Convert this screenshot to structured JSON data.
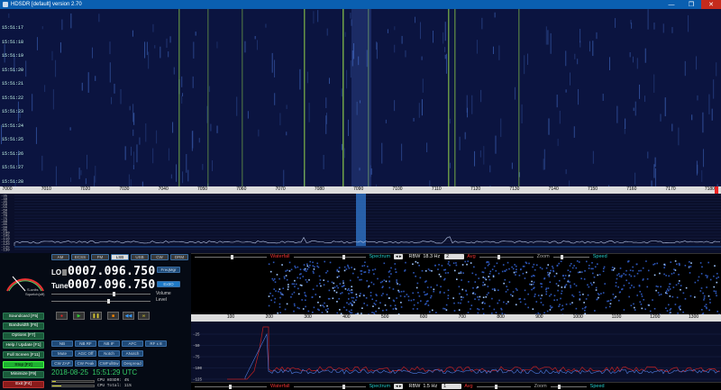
{
  "window": {
    "title": "HDSDR [default] version 2.70",
    "minimize": "—",
    "maximize": "❐",
    "close": "✕"
  },
  "waterfall_times": [
    "15:51:17",
    "15:51:18",
    "15:51:19",
    "15:51:20",
    "15:51:21",
    "15:51:22",
    "15:51:23",
    "15:51:24",
    "15:51:25",
    "15:51:26",
    "15:51:27",
    "15:51:28"
  ],
  "freq_ticks": [
    "7000",
    "7010",
    "7020",
    "7030",
    "7040",
    "7050",
    "7060",
    "7070",
    "7080",
    "7090",
    "7100",
    "7110",
    "7120",
    "7130",
    "7140",
    "7150",
    "7160",
    "7170",
    "7180"
  ],
  "spectrum_db": [
    "-35",
    "-40",
    "-45",
    "-50",
    "-55",
    "-60",
    "-65",
    "-70",
    "-75",
    "-80",
    "-85",
    "-90",
    "-95",
    "-100",
    "-105",
    "-110",
    "-115",
    "-120",
    "-125",
    "-130"
  ],
  "mode_buttons": [
    "AM",
    "ECSS",
    "FM",
    "LSB",
    "USB",
    "CW",
    "DRM"
  ],
  "lo": {
    "label": "LO",
    "value": "0007.096.750"
  },
  "tune": {
    "label": "Tune",
    "value": "0007.096.750"
  },
  "freqmgr": "FreqMgr",
  "extio": "ExtIO",
  "volume_label": "Volume",
  "level_label": "Level",
  "smeter": {
    "label": "S-units",
    "sublabel": "Squelch(off)"
  },
  "side_buttons": [
    "Soundcard [F5]",
    "Bandwidth [F6]",
    "Options [F7]",
    "Help / Update [F1]",
    "Full Screen [F11]",
    "Stop [F2]",
    "Minimize [F9]",
    "Exit [F4]"
  ],
  "nr_buttons": [
    "NB",
    "NB RF",
    "NB IF",
    "AFC",
    "RF x 8",
    "Mute",
    "AGC Off",
    "Notch",
    "ANotch",
    "CW ZAP",
    "CW Peak",
    "CWFullBw",
    "Despread"
  ],
  "datetime": "2018-08-25  15:51:29 UTC",
  "cpu": {
    "hdsdr": "CPU HDSDR: 4%",
    "total": "CPU Total: 11%"
  },
  "top_bar": {
    "waterfall": "Waterfall",
    "spectrum": "Spectrum",
    "rbw_label": "RBW",
    "rbw_value": "18.3 Hz",
    "avg_value": "2",
    "avg": "Avg",
    "zoom": "Zoom",
    "speed": "Speed"
  },
  "bottom_bar": {
    "waterfall": "Waterfall",
    "spectrum": "Spectrum",
    "rbw_label": "RBW",
    "rbw_value": "1.5 Hz",
    "avg_value": "1",
    "avg": "Avg",
    "zoom": "Zoom",
    "speed": "Speed"
  },
  "af_ticks": [
    "100",
    "200",
    "300",
    "400",
    "500",
    "600",
    "700",
    "800",
    "900",
    "1000",
    "1100",
    "1200",
    "1300"
  ],
  "af_db": [
    "-25",
    "-50",
    "-75",
    "-100",
    "-125"
  ],
  "colors": {
    "waterfall_bg": "#0b1440",
    "signal": "#9be04a",
    "spectrum_bg": "#0a0f2a",
    "accent": "#2bb2ff"
  }
}
